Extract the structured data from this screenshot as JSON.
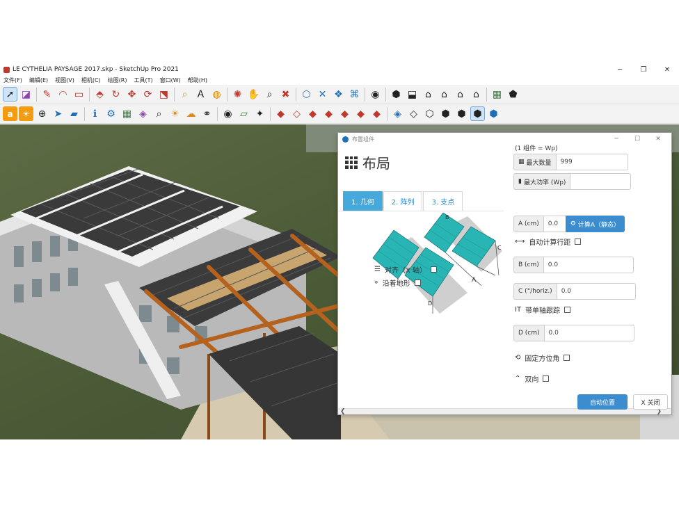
{
  "window": {
    "title": "LE CYTHELIA PAYSAGE 2017.skp - SketchUp Pro 2021",
    "minimize": "─",
    "maximize": "❐",
    "close": "✕"
  },
  "menu": [
    "文件(F)",
    "编辑(E)",
    "视图(V)",
    "相机(C)",
    "绘图(R)",
    "工具(T)",
    "窗口(W)",
    "帮助(H)"
  ],
  "dialog": {
    "title": "布置组件",
    "minimize": "─",
    "maximize": "☐",
    "close": "✕",
    "heading": "布局",
    "tabs": [
      "1. 几何",
      "2. 阵列",
      "3. 支点"
    ],
    "diagram_labels": {
      "a": "A",
      "b": "B",
      "c": "C",
      "d": "D"
    },
    "align": {
      "label": "对齐（X 轴）"
    },
    "follow_terrain": {
      "label": "沿着地形"
    },
    "wp_note": "(1 组件 = Wp)",
    "max_count": {
      "label": "最大数量",
      "value": "999"
    },
    "max_power": {
      "label": "最大功率 (Wp)",
      "value": ""
    },
    "a_field": {
      "label": "A (cm)",
      "value": "0.0",
      "button": "计算A（静态）"
    },
    "auto_row": {
      "label": "自动计算行距"
    },
    "b_field": {
      "label": "B (cm)",
      "value": "0.0"
    },
    "c_field": {
      "label": "C (°/horiz.)",
      "value": "0.0"
    },
    "single_axis": {
      "label": "带单轴跟踪"
    },
    "d_field": {
      "label": "D (cm)",
      "value": "0.0"
    },
    "fixed_azimuth": {
      "label": "固定方位角"
    },
    "bidirectional": {
      "label": "双向"
    },
    "auto_place_button": "自动位置",
    "close_button": "X 关闭",
    "scroll_left": "❮",
    "scroll_right": "❯"
  },
  "colors": {
    "accent": "#3c8dcf",
    "active_tab": "#45a9dc",
    "panel": "#2ab5b5",
    "roof_panels": "#3a3a3a",
    "beam": "#b5621f"
  }
}
